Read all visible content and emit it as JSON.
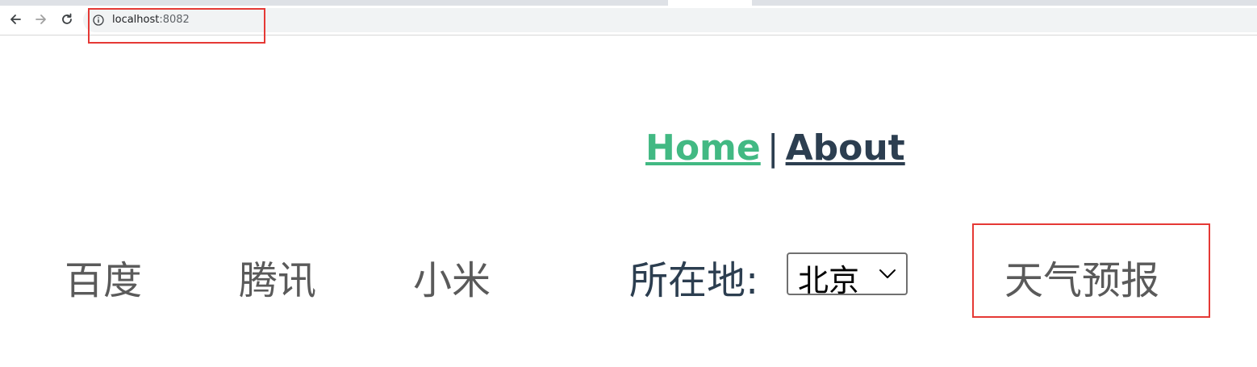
{
  "browser": {
    "url_host": "localhost",
    "url_port": ":8082"
  },
  "nav": {
    "home": "Home",
    "separator": "|",
    "about": "About"
  },
  "companies": [
    "百度",
    "腾讯",
    "小米"
  ],
  "location": {
    "label": "所在地:",
    "selected": "北京"
  },
  "weather_link": "天气预报",
  "colors": {
    "home_link": "#42b983",
    "about_link": "#2c3e50",
    "annotation_box": "#e53935"
  },
  "icons": [
    "back-arrow-icon",
    "forward-arrow-icon",
    "reload-icon",
    "info-icon",
    "chevron-down-icon"
  ]
}
